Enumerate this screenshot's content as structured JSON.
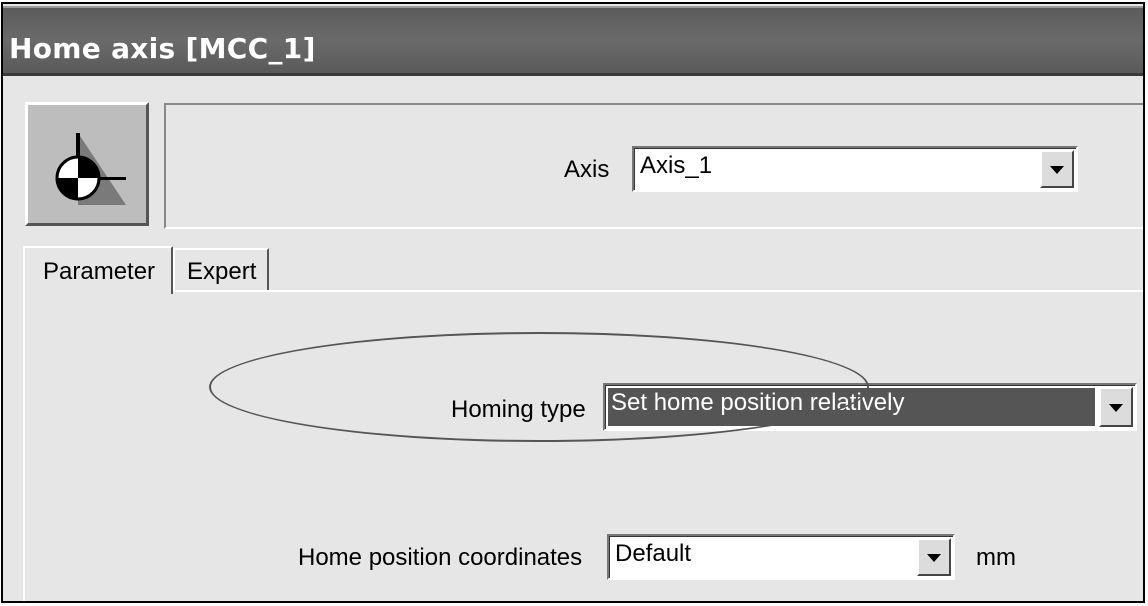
{
  "window": {
    "title": "Home axis [MCC_1]"
  },
  "axis_selector": {
    "label": "Axis",
    "value": "Axis_1"
  },
  "tabs": [
    {
      "label": "Parameter",
      "active": true
    },
    {
      "label": "Expert",
      "active": false
    }
  ],
  "parameters": {
    "homing_type": {
      "label": "Homing type",
      "value": "Set home position relatively"
    },
    "home_position": {
      "label": "Home position coordinates",
      "value": "Default",
      "unit": "mm"
    }
  },
  "icons": {
    "tool": "homing-axis-icon",
    "dropdown": "chevron-down-icon"
  },
  "colors": {
    "titlebar": "#5c5c5c",
    "selection": "#555555",
    "background": "#e6e6e6"
  }
}
